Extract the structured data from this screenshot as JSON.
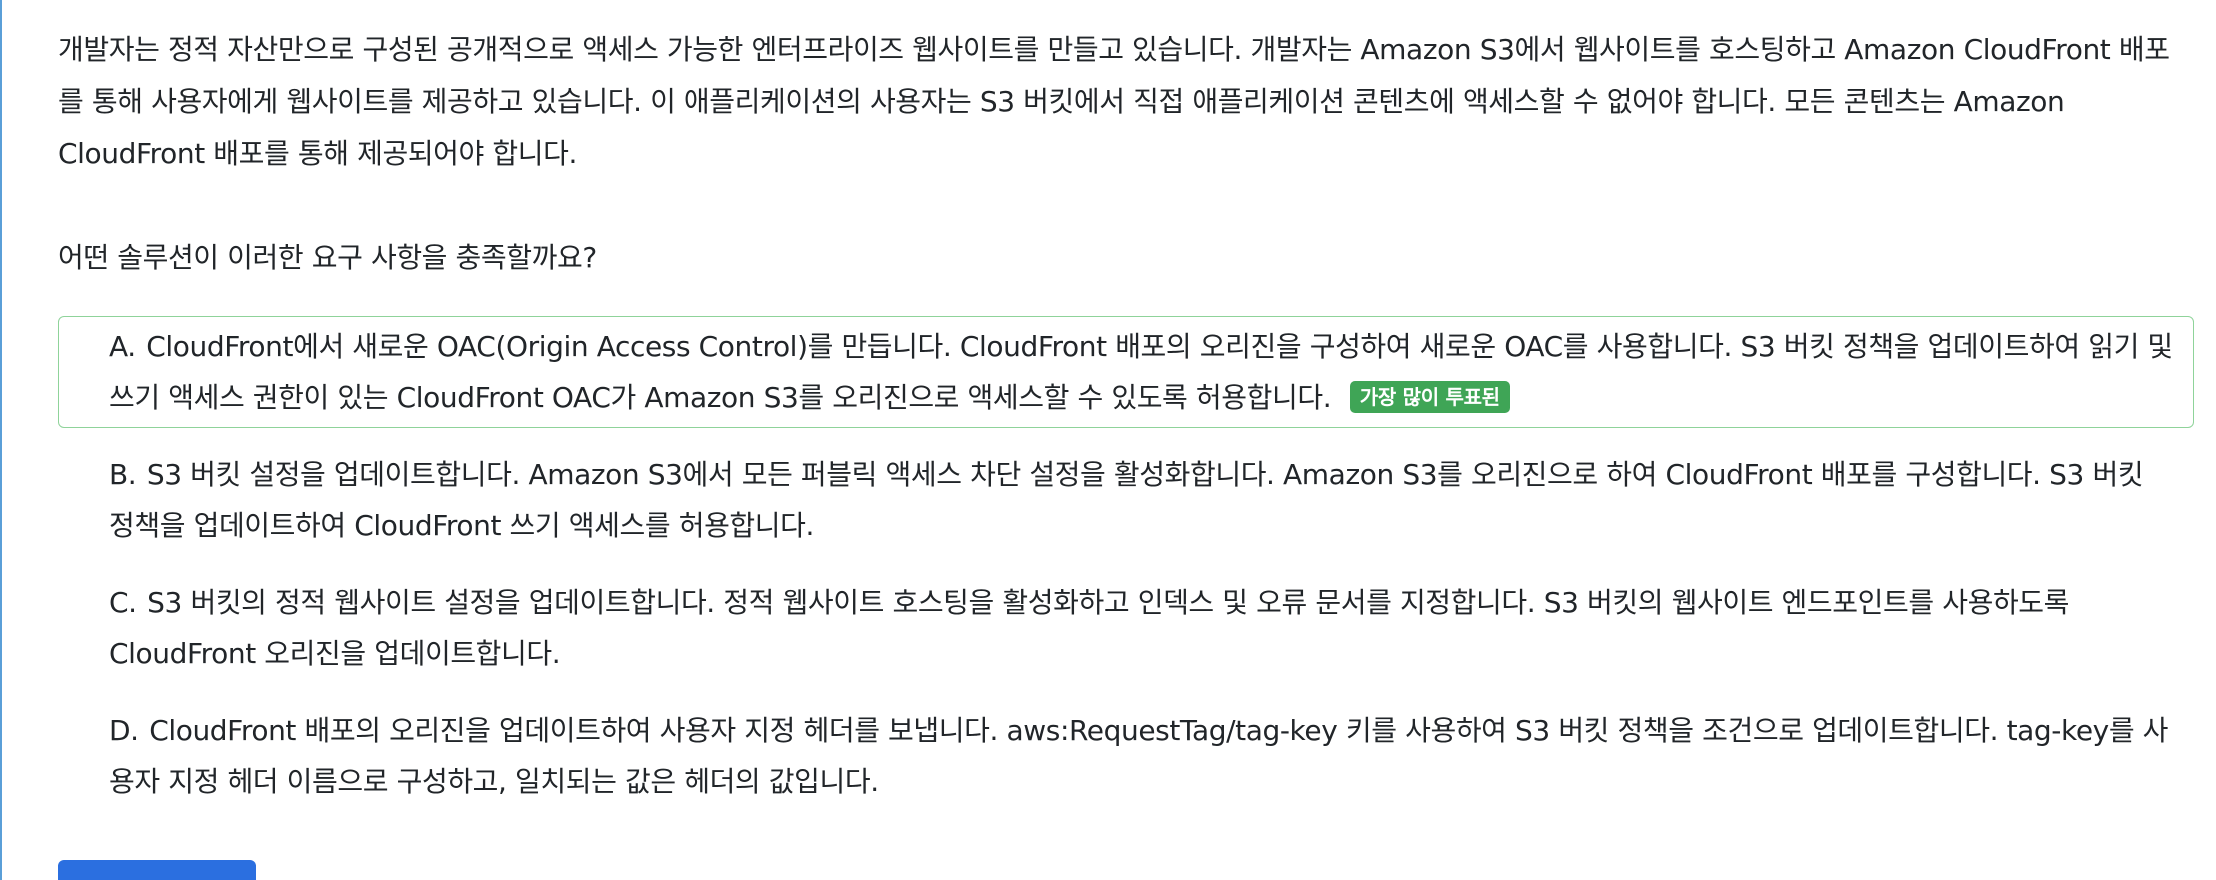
{
  "question": {
    "text": "개발자는 정적 자산만으로 구성된 공개적으로 액세스 가능한 엔터프라이즈 웹사이트를 만들고 있습니다. 개발자는 Amazon S3에서 웹사이트를 호스팅하고 Amazon CloudFront 배포를 통해 사용자에게 웹사이트를 제공하고 있습니다. 이 애플리케이션의 사용자는 S3 버킷에서 직접 애플리케이션 콘텐츠에 액세스할 수 없어야 합니다. 모든 콘텐츠는 Amazon CloudFront 배포를 통해 제공되어야 합니다.",
    "prompt": "어떤 솔루션이 이러한 요구 사항을 충족할까요?"
  },
  "choices": [
    {
      "letter": "A.",
      "text": "CloudFront에서 새로운 OAC(Origin Access Control)를 만듭니다. CloudFront 배포의 오리진을 구성하여 새로운 OAC를 사용합니다. S3 버킷 정책을 업데이트하여 읽기 및 쓰기 액세스 권한이 있는 CloudFront OAC가 Amazon S3를 오리진으로 액세스할 수 있도록 허용합니다.",
      "badge": "가장 많이 투표된"
    },
    {
      "letter": "B.",
      "text": "S3 버킷 설정을 업데이트합니다. Amazon S3에서 모든 퍼블릭 액세스 차단 설정을 활성화합니다. Amazon S3를 오리진으로 하여 CloudFront 배포를 구성합니다. S3 버킷 정책을 업데이트하여 CloudFront 쓰기 액세스를 허용합니다."
    },
    {
      "letter": "C.",
      "text": "S3 버킷의 정적 웹사이트 설정을 업데이트합니다. 정적 웹사이트 호스팅을 활성화하고 인덱스 및 오류 문서를 지정합니다. S3 버킷의 웹사이트 엔드포인트를 사용하도록 CloudFront 오리진을 업데이트합니다."
    },
    {
      "letter": "D.",
      "text": "CloudFront 배포의 오리진을 업데이트하여 사용자 지정 헤더를 보냅니다. aws:RequestTag/tag-key 키를 사용하여 S3 버킷 정책을 조건으로 업데이트합니다. tag-key를 사용자 지정 헤더 이름으로 구성하고, 일치되는 값은 헤더의 값입니다."
    }
  ],
  "colors": {
    "accent_rule": "#5a9fd8",
    "correct_border": "#8fd39a",
    "badge_bg": "#3fa556",
    "button_bg": "#2b6fe0"
  }
}
